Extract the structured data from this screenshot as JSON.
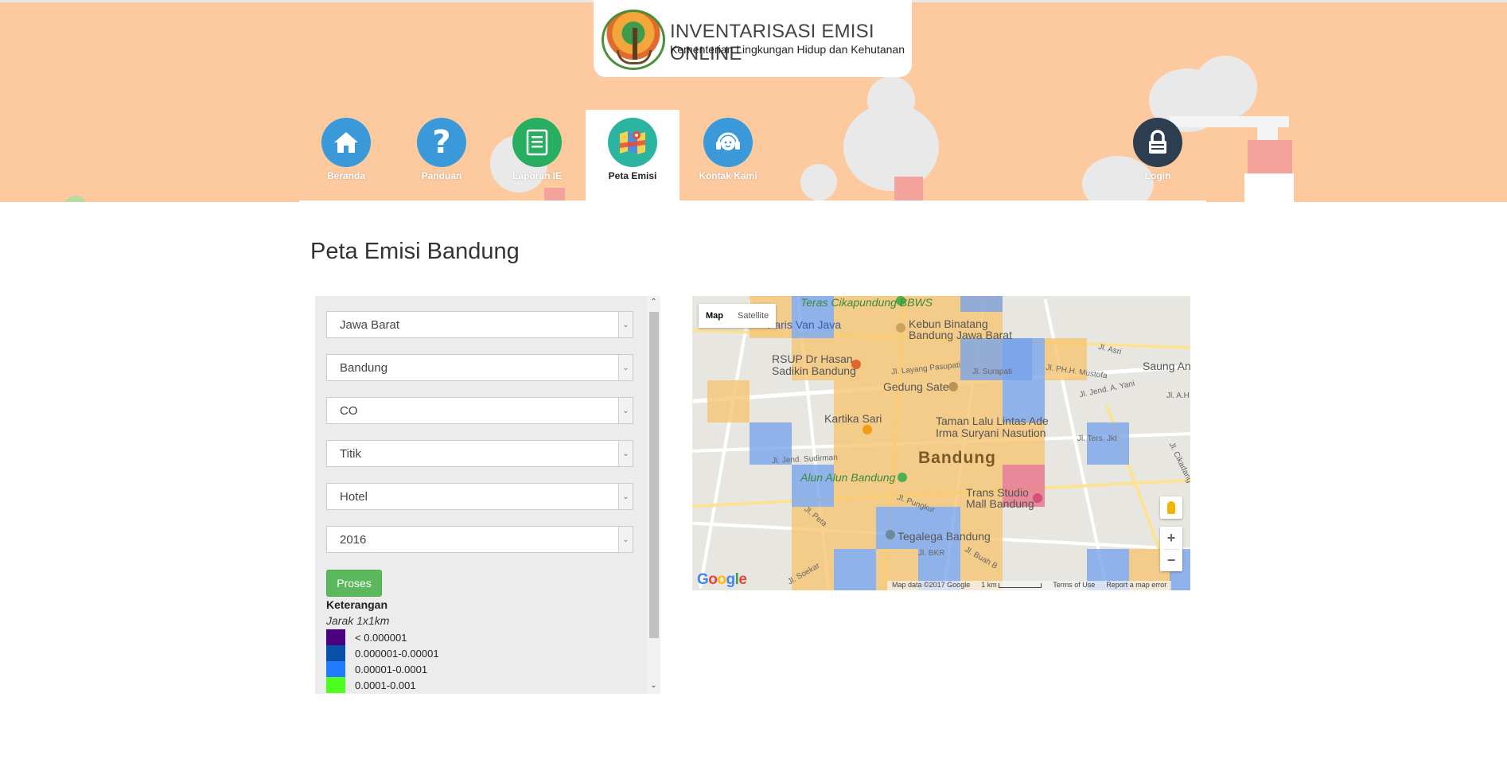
{
  "header": {
    "logo_title": "INVENTARISASI EMISI ONLINE",
    "logo_subtitle": "Kementerian Lingkungan Hidup dan Kehutanan"
  },
  "nav": [
    {
      "label": "Beranda",
      "icon": "home-icon",
      "color": "#3a9ad9"
    },
    {
      "label": "Panduan",
      "icon": "question-icon",
      "color": "#3a9ad9"
    },
    {
      "label": "Laporan IE",
      "icon": "document-icon",
      "color": "#27ae60"
    },
    {
      "label": "Peta Emisi",
      "icon": "map-icon",
      "color": "#2bb5a0",
      "active": true
    },
    {
      "label": "Kontak Kami",
      "icon": "headset-icon",
      "color": "#3a9ad9"
    },
    {
      "label": "Login",
      "icon": "lock-icon",
      "color": "#2c3e50"
    }
  ],
  "page_title": "Peta Emisi Bandung",
  "filters": {
    "province": "Jawa Barat",
    "city": "Bandung",
    "pollutant": "CO",
    "display_type": "Titik",
    "source": "Hotel",
    "year": "2016"
  },
  "process_button": "Proses",
  "legend": {
    "title": "Keterangan",
    "subtitle": "Jarak 1x1km",
    "items": [
      {
        "label": "< 0.000001",
        "color": "#4b0082"
      },
      {
        "label": "0.000001-0.00001",
        "color": "#0a4fa8"
      },
      {
        "label": "0.00001-0.0001",
        "color": "#1f7cff"
      },
      {
        "label": "0.0001-0.001",
        "color": "#4cff1f"
      }
    ]
  },
  "map": {
    "type_map": "Map",
    "type_satellite": "Satellite",
    "city_label": "Bandung",
    "places": [
      "Teras Cikapundung BBWS",
      "Paris Van Java",
      "Kebun Binatang Bandung Jawa Barat",
      "RSUP Dr Hasan Sadikin Bandung",
      "Gedung Sate",
      "Kartika Sari",
      "Taman Lalu Lintas Ade Irma Suryani Nasution",
      "Alun Alun Bandung",
      "Trans Studio Mall Bandung",
      "Tegalega Bandung",
      "Saung Angk"
    ],
    "streets": [
      "Jl. Layang Pasupati",
      "Jl. Surapati",
      "Jl. PH.H. Mustofa",
      "Jl. Jend. A. Yani",
      "Jl. Jend. Sudirman",
      "Jl. Ters. Jkt",
      "Jl. Pungkur",
      "Jl. Peta",
      "Jl. BKR",
      "Jl. Buah B",
      "Jl. Soekar",
      "Jl. Asri",
      "Jl. A.H",
      "Jl. Cikadang"
    ],
    "zoom_in": "+",
    "zoom_out": "−",
    "google": "Google",
    "map_data": "Map data ©2017 Google",
    "scale": "1 km",
    "terms": "Terms of Use",
    "report": "Report a map error"
  }
}
